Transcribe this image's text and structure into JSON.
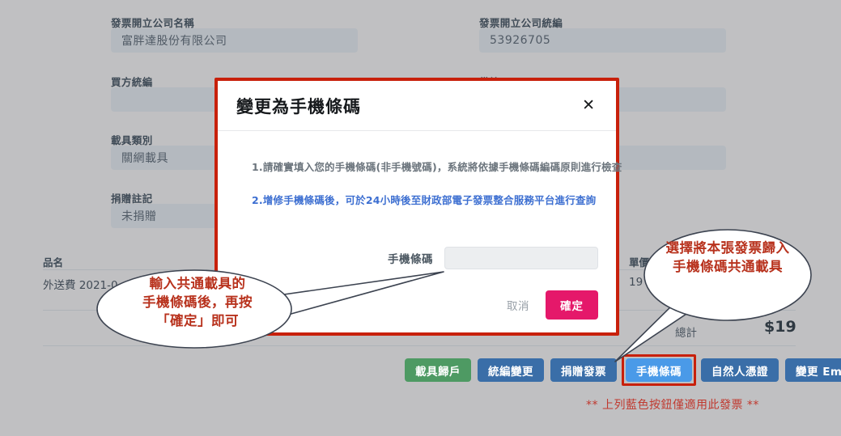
{
  "form": {
    "fields": [
      {
        "label": "發票開立公司名稱",
        "value": "富胖達股份有限公司"
      },
      {
        "label": "發票開立公司統編",
        "value": "53926705"
      },
      {
        "label": "買方統編",
        "value": ""
      },
      {
        "label": "備註",
        "value": ""
      },
      {
        "label": "載具類別",
        "value": "關網載具"
      },
      {
        "label": "捐贈註記",
        "value": "未捐贈"
      }
    ]
  },
  "items_table": {
    "headers": {
      "name": "品名",
      "unit_price": "單價"
    },
    "row": {
      "name": "外送費 2021-0",
      "unit_price": "19"
    },
    "total_label": "總計",
    "total_value": "$19"
  },
  "modal": {
    "title": "變更為手機條碼",
    "close_label": "✕",
    "notes": [
      "1.請確實填入您的手機條碼(非手機號碼)，系統將依據手機條碼編碼原則進行檢查",
      "2.增修手機條碼後，可於24小時後至財政部電子發票整合服務平台進行查詢"
    ],
    "input_label": "手機條碼",
    "input_value": "",
    "input_placeholder": "",
    "cancel_label": "取消",
    "confirm_label": "確定"
  },
  "action_buttons": [
    {
      "label": "載具歸戶",
      "style": "green",
      "highlighted": false
    },
    {
      "label": "統編變更",
      "style": "blue",
      "highlighted": false
    },
    {
      "label": "捐贈發票",
      "style": "blue",
      "highlighted": false
    },
    {
      "label": "手機條碼",
      "style": "highlight",
      "highlighted": true
    },
    {
      "label": "自然人憑證",
      "style": "blue",
      "highlighted": false
    },
    {
      "label": "變更 Email",
      "style": "blue",
      "highlighted": false
    }
  ],
  "footnote": "** 上列藍色按鈕僅適用此發票 **",
  "callouts": {
    "left": "輸入共通載具的\n手機條碼後，再按\n「確定」即可",
    "right": "選擇將本張發票歸入\n手機條碼共通載具"
  },
  "colors": {
    "page_background": "#c0c0c2",
    "highlight_outline": "#c8200b",
    "confirm_button": "#e5186a",
    "green_button": "#4e9a63",
    "blue_button": "#3a6ea8",
    "highlight_button": "#4a9ae8",
    "callout_text": "#b8321d",
    "note_blue": "#3d6fd1"
  }
}
